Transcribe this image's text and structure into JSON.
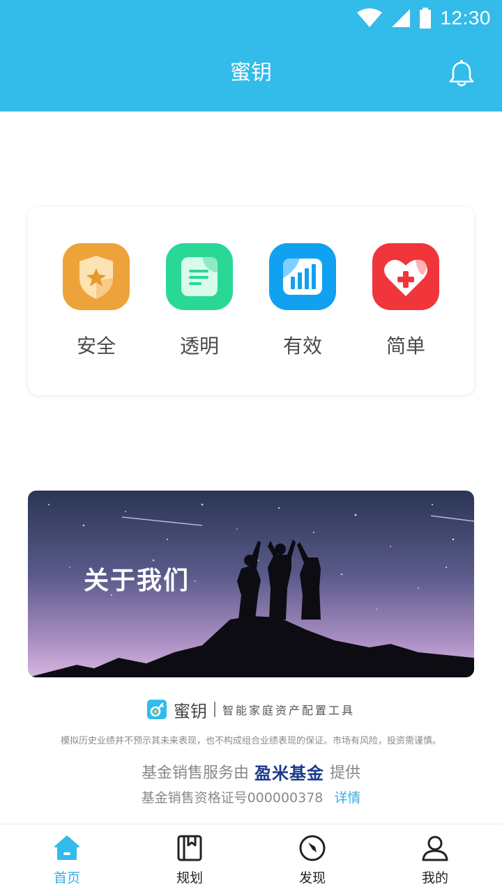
{
  "status_bar": {
    "time": "12:30"
  },
  "app_bar": {
    "title": "蜜钥"
  },
  "features": [
    {
      "label": "安全",
      "icon": "shield-star-icon",
      "color": "#eda33a"
    },
    {
      "label": "透明",
      "icon": "document-lines-icon",
      "color": "#2ad896"
    },
    {
      "label": "有效",
      "icon": "bar-chart-icon",
      "color": "#12a0f0"
    },
    {
      "label": "简单",
      "icon": "heart-plus-icon",
      "color": "#f0363a"
    }
  ],
  "banner": {
    "title": "关于我们"
  },
  "brand": {
    "name": "蜜钥",
    "slogan": "智能家庭资产配置工具"
  },
  "disclaimer": "模拟历史业绩并不预示其未来表现，也不构成组合业绩表现的保证。市场有风险，投资需谨慎。",
  "sales": {
    "prefix": "基金销售服务由",
    "partner": "盈米基金",
    "suffix": "提供"
  },
  "license": {
    "text": "基金销售资格证号000000378",
    "link": "详情"
  },
  "bottom_nav": [
    {
      "label": "首页",
      "icon": "home-icon",
      "active": true
    },
    {
      "label": "规划",
      "icon": "planner-book-icon",
      "active": false
    },
    {
      "label": "发现",
      "icon": "compass-icon",
      "active": false
    },
    {
      "label": "我的",
      "icon": "profile-icon",
      "active": false
    }
  ],
  "colors": {
    "primary": "#33bbe9",
    "accent": "#33aee4"
  }
}
